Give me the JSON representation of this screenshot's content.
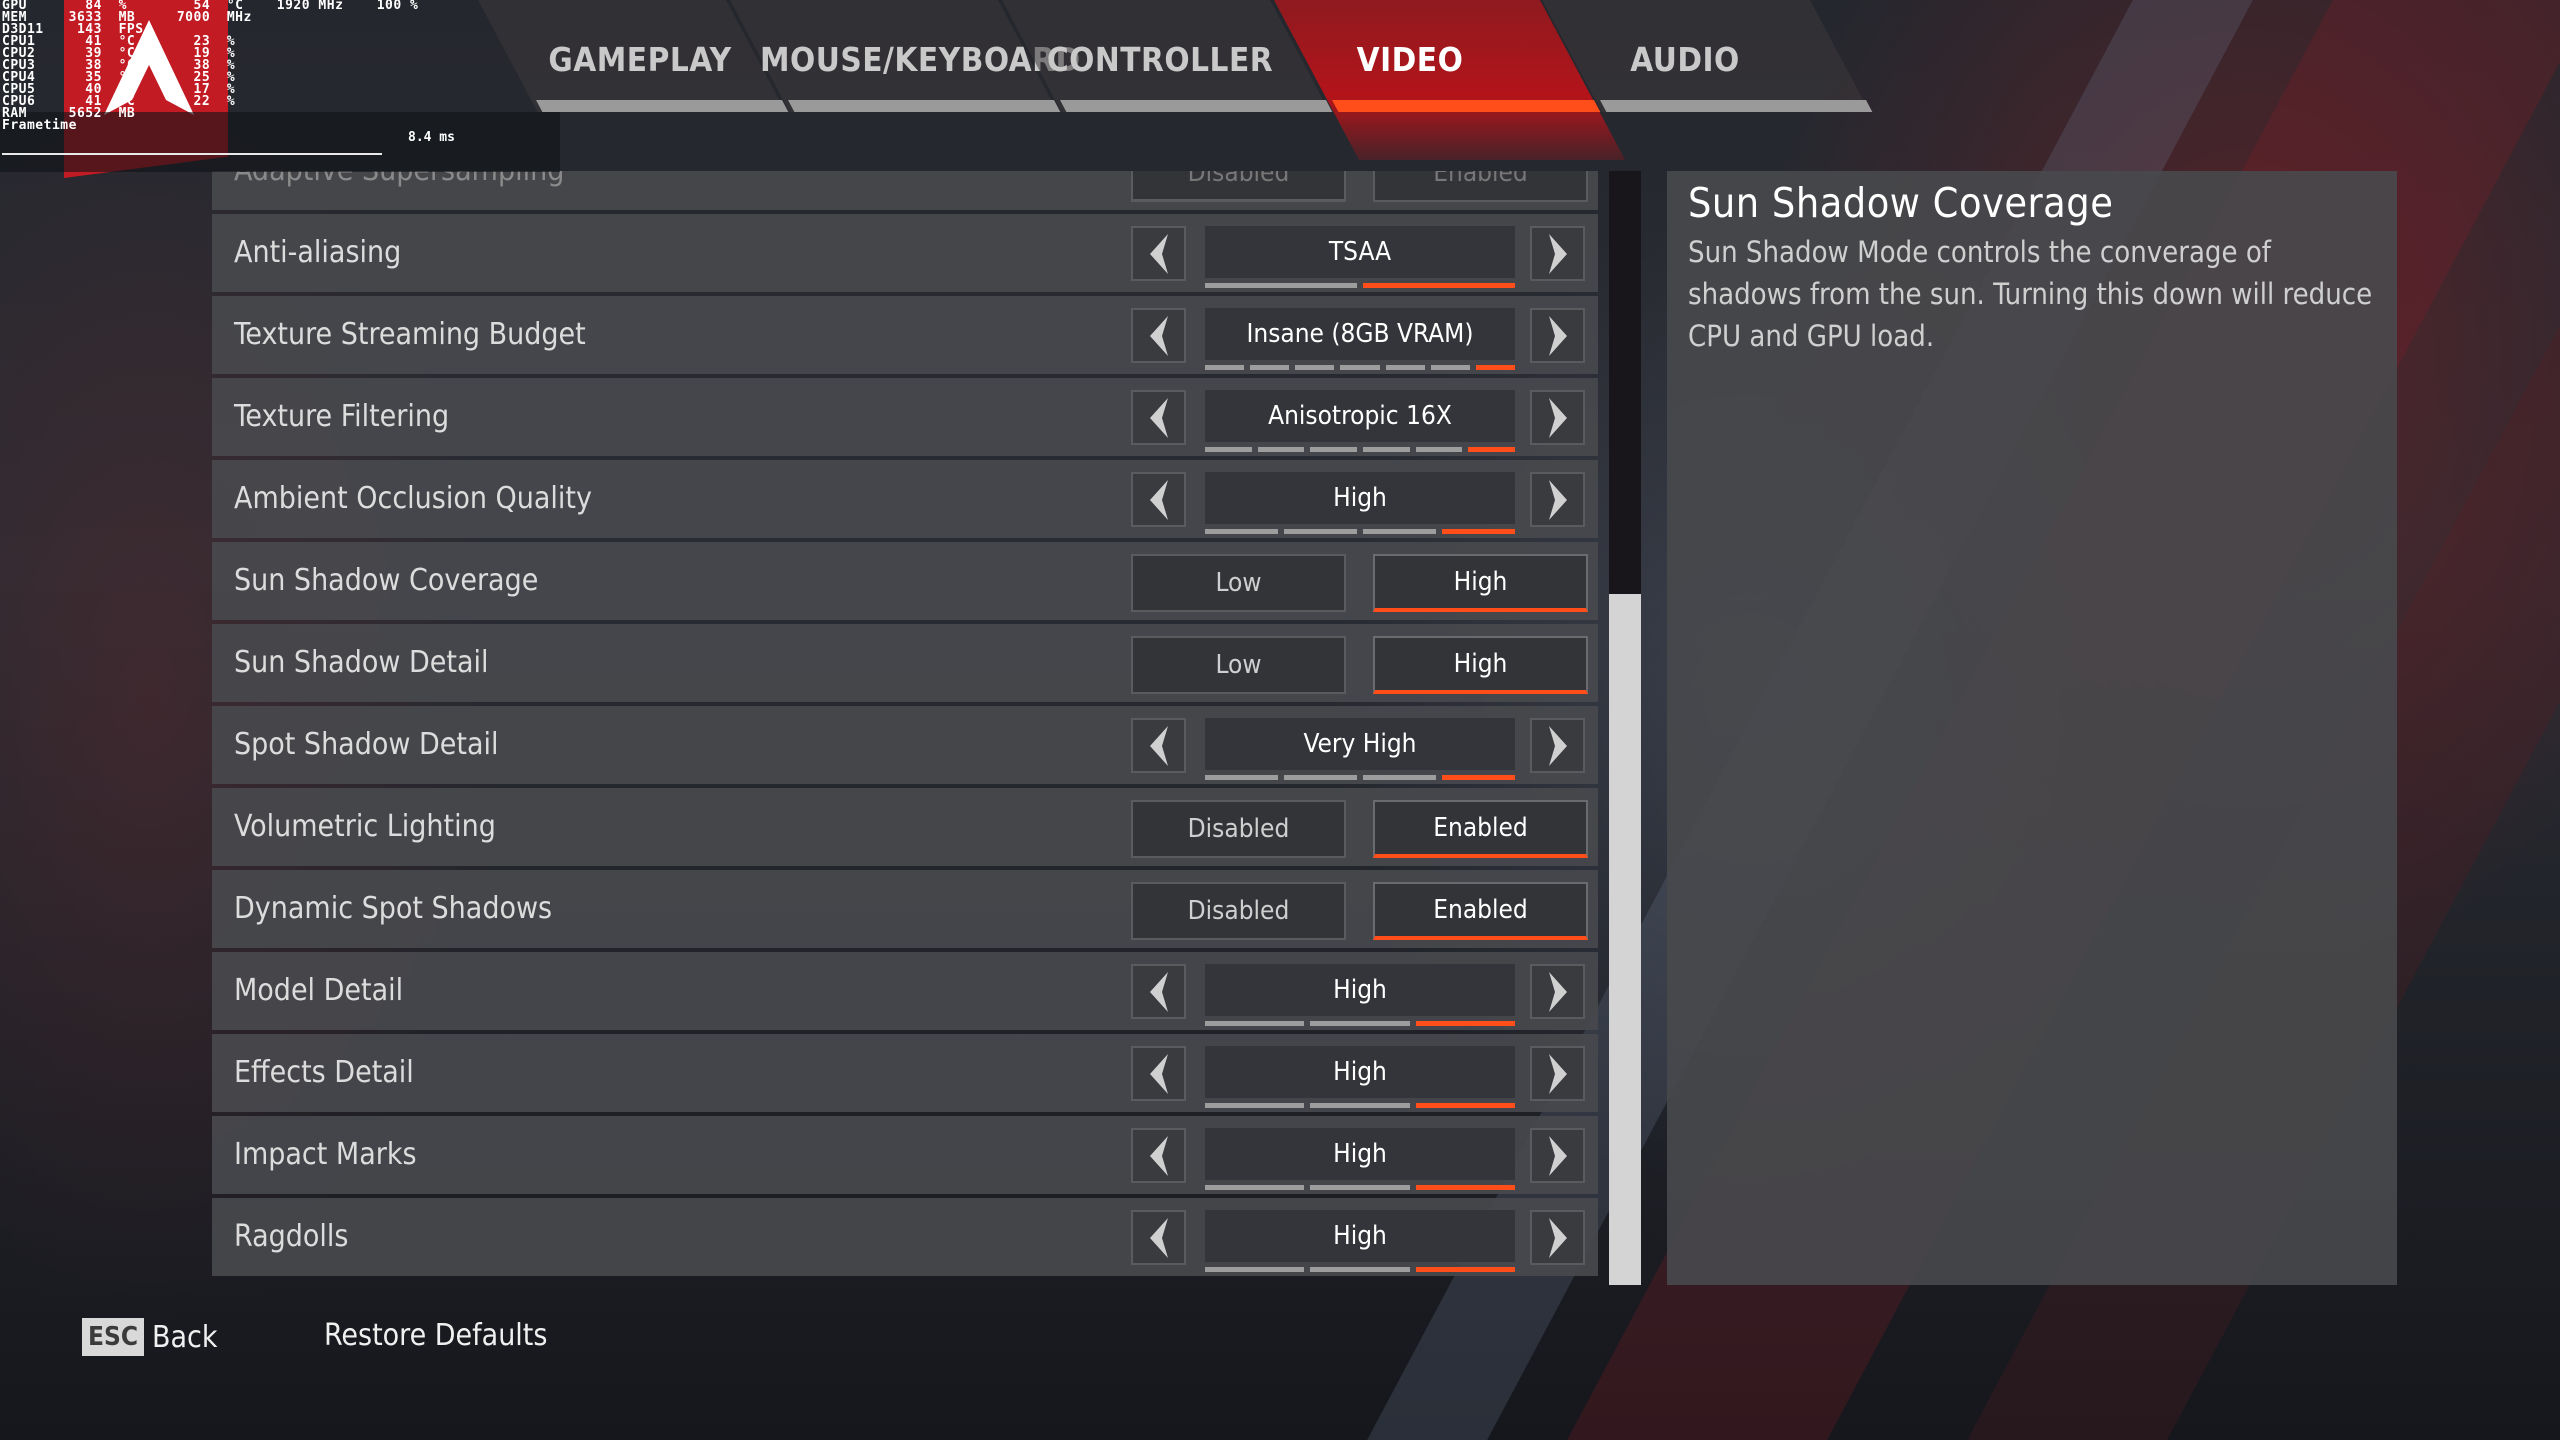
{
  "overlay": {
    "lines": [
      "GPU       84  %        54  °C    1920 MHz    100 %",
      "MEM     3633  MB     7000  MHz",
      "D3D11    143  FPS",
      "CPU1      41  °C       23  %",
      "CPU2      39  °C       19  %",
      "CPU3      38  °C       38  %",
      "CPU4      35  °C       25  %",
      "CPU5      40  °C       17  %",
      "CPU6      41  °C       22  %",
      "RAM     5652  MB",
      "Frametime"
    ],
    "frametime_value": "8.4 ms"
  },
  "tabs": [
    {
      "label": "GAMEPLAY",
      "active": false
    },
    {
      "label": "MOUSE/KEYBOARD",
      "active": false
    },
    {
      "label": "CONTROLLER",
      "active": false
    },
    {
      "label": "VIDEO",
      "active": true
    },
    {
      "label": "AUDIO",
      "active": false
    }
  ],
  "settings": [
    {
      "label": "Adaptive Supersampling",
      "type": "toggle",
      "options": [
        "Disabled",
        "Enabled"
      ],
      "selected": 0,
      "faded": true
    },
    {
      "label": "Anti-aliasing",
      "type": "cycle",
      "value": "TSAA",
      "levels": 2,
      "level": 2
    },
    {
      "label": "Texture Streaming Budget",
      "type": "cycle",
      "value": "Insane (8GB VRAM)",
      "levels": 7,
      "level": 7
    },
    {
      "label": "Texture Filtering",
      "type": "cycle",
      "value": "Anisotropic 16X",
      "levels": 6,
      "level": 6
    },
    {
      "label": "Ambient Occlusion Quality",
      "type": "cycle",
      "value": "High",
      "levels": 4,
      "level": 4
    },
    {
      "label": "Sun Shadow Coverage",
      "type": "toggle",
      "options": [
        "Low",
        "High"
      ],
      "selected": 1
    },
    {
      "label": "Sun Shadow Detail",
      "type": "toggle",
      "options": [
        "Low",
        "High"
      ],
      "selected": 1
    },
    {
      "label": "Spot Shadow Detail",
      "type": "cycle",
      "value": "Very High",
      "levels": 4,
      "level": 4
    },
    {
      "label": "Volumetric Lighting",
      "type": "toggle",
      "options": [
        "Disabled",
        "Enabled"
      ],
      "selected": 1
    },
    {
      "label": "Dynamic Spot Shadows",
      "type": "toggle",
      "options": [
        "Disabled",
        "Enabled"
      ],
      "selected": 1
    },
    {
      "label": "Model Detail",
      "type": "cycle",
      "value": "High",
      "levels": 3,
      "level": 3
    },
    {
      "label": "Effects Detail",
      "type": "cycle",
      "value": "High",
      "levels": 3,
      "level": 3
    },
    {
      "label": "Impact Marks",
      "type": "cycle",
      "value": "High",
      "levels": 3,
      "level": 3
    },
    {
      "label": "Ragdolls",
      "type": "cycle",
      "value": "High",
      "levels": 3,
      "level": 3
    }
  ],
  "scroll": {
    "position_fraction": 0.38,
    "thumb_fraction": 0.62
  },
  "description": {
    "title": "Sun Shadow Coverage",
    "text": "Sun Shadow Mode controls the converage of shadows from the sun. Turning this down will reduce CPU and GPU load."
  },
  "footer": {
    "esc_key": "ESC",
    "back_label": "Back",
    "restore_label": "Restore Defaults"
  },
  "colors": {
    "accent": "#ff4e1a",
    "tab_active_bg": "#b3141a",
    "logo_red": "#c21b24"
  }
}
